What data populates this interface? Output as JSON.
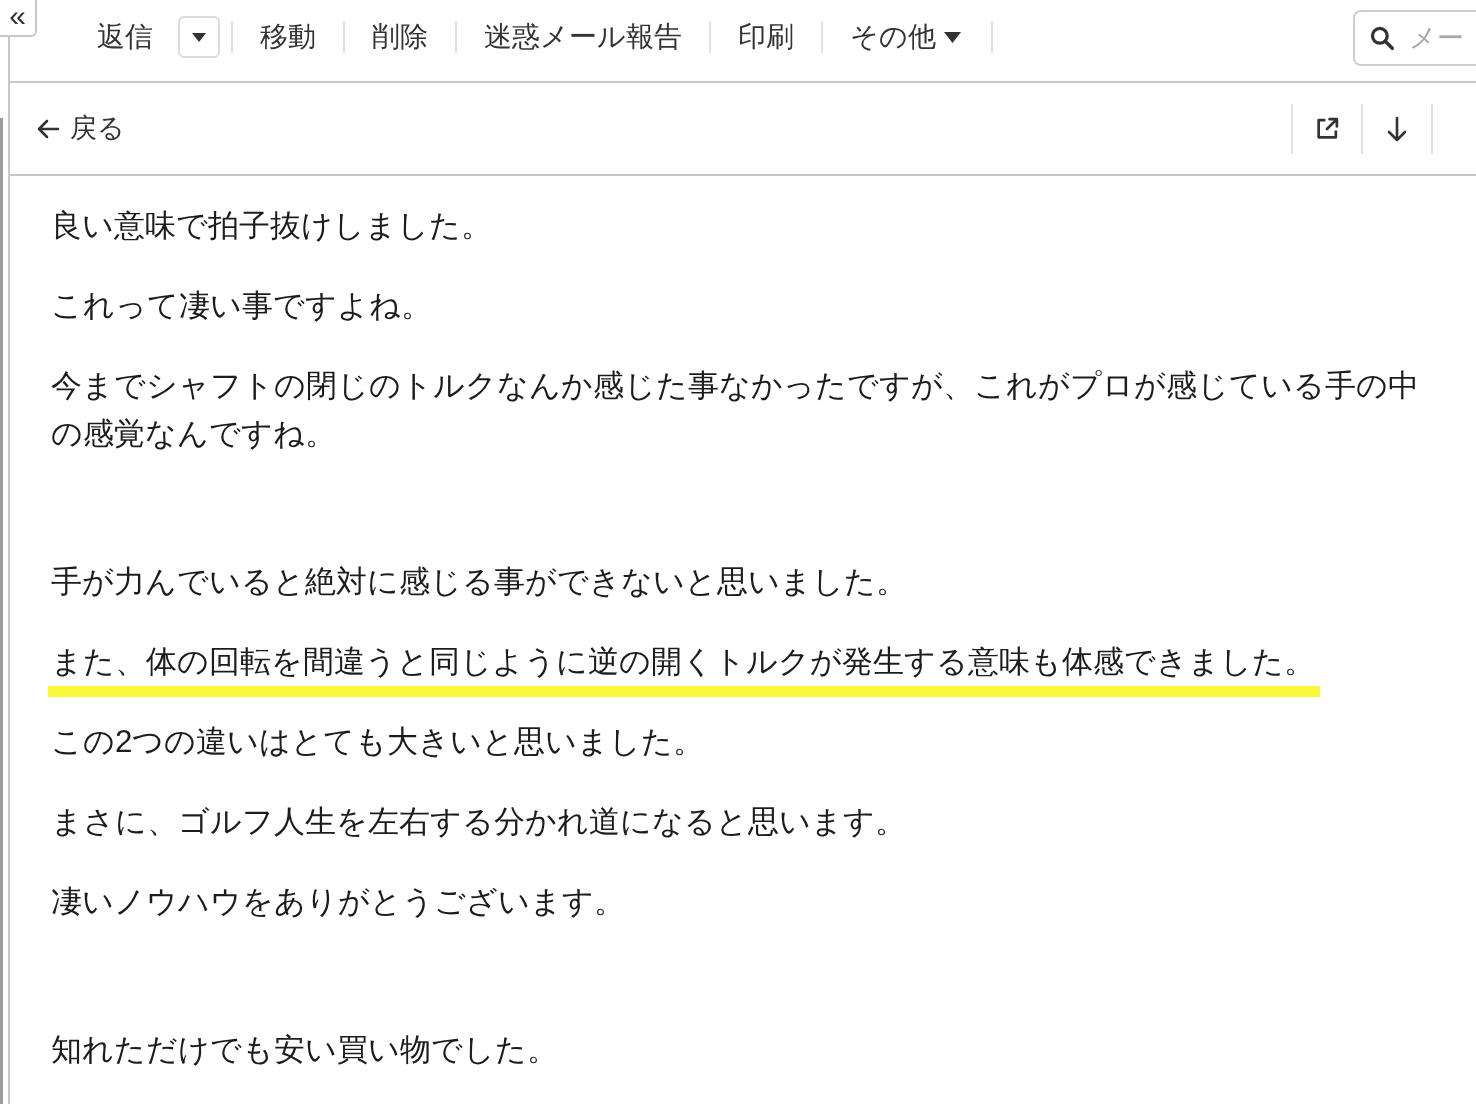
{
  "sidebar_toggle": {
    "label": "«"
  },
  "toolbar": {
    "actions": [
      {
        "kind": "split",
        "label": "返信"
      },
      {
        "kind": "plain",
        "label": "移動"
      },
      {
        "kind": "plain",
        "label": "削除"
      },
      {
        "kind": "plain",
        "label": "迷惑メール報告"
      },
      {
        "kind": "plain",
        "label": "印刷"
      },
      {
        "kind": "menu",
        "label": "その他"
      }
    ],
    "search": {
      "placeholder": "メー"
    }
  },
  "message_bar": {
    "back": {
      "label": "戻る"
    }
  },
  "body": {
    "sections": [
      {
        "paragraphs": [
          {
            "text": "良い意味で拍子抜けしました。",
            "highlighted": false
          },
          {
            "text": "これって凄い事ですよね。",
            "highlighted": false
          },
          {
            "text": "今までシャフトの閉じのトルクなんか感じた事なかったですが、これがプロが感じている手の中の感覚なんですね。",
            "highlighted": false
          }
        ]
      },
      {
        "paragraphs": [
          {
            "text": "手が力んでいると絶対に感じる事ができないと思いました。",
            "highlighted": false
          },
          {
            "text": "また、体の回転を間違うと同じように逆の開くトルクが発生する意味も体感できました。",
            "highlighted": true
          },
          {
            "text": "この2つの違いはとても大きいと思いました。",
            "highlighted": false
          },
          {
            "text": "まさに、ゴルフ人生を左右する分かれ道になると思います。",
            "highlighted": false
          },
          {
            "text": "凄いノウハウをありがとうございます。",
            "highlighted": false
          }
        ]
      },
      {
        "paragraphs": [
          {
            "text": "知れただけでも安い買い物でした。",
            "highlighted": false
          }
        ]
      }
    ]
  }
}
